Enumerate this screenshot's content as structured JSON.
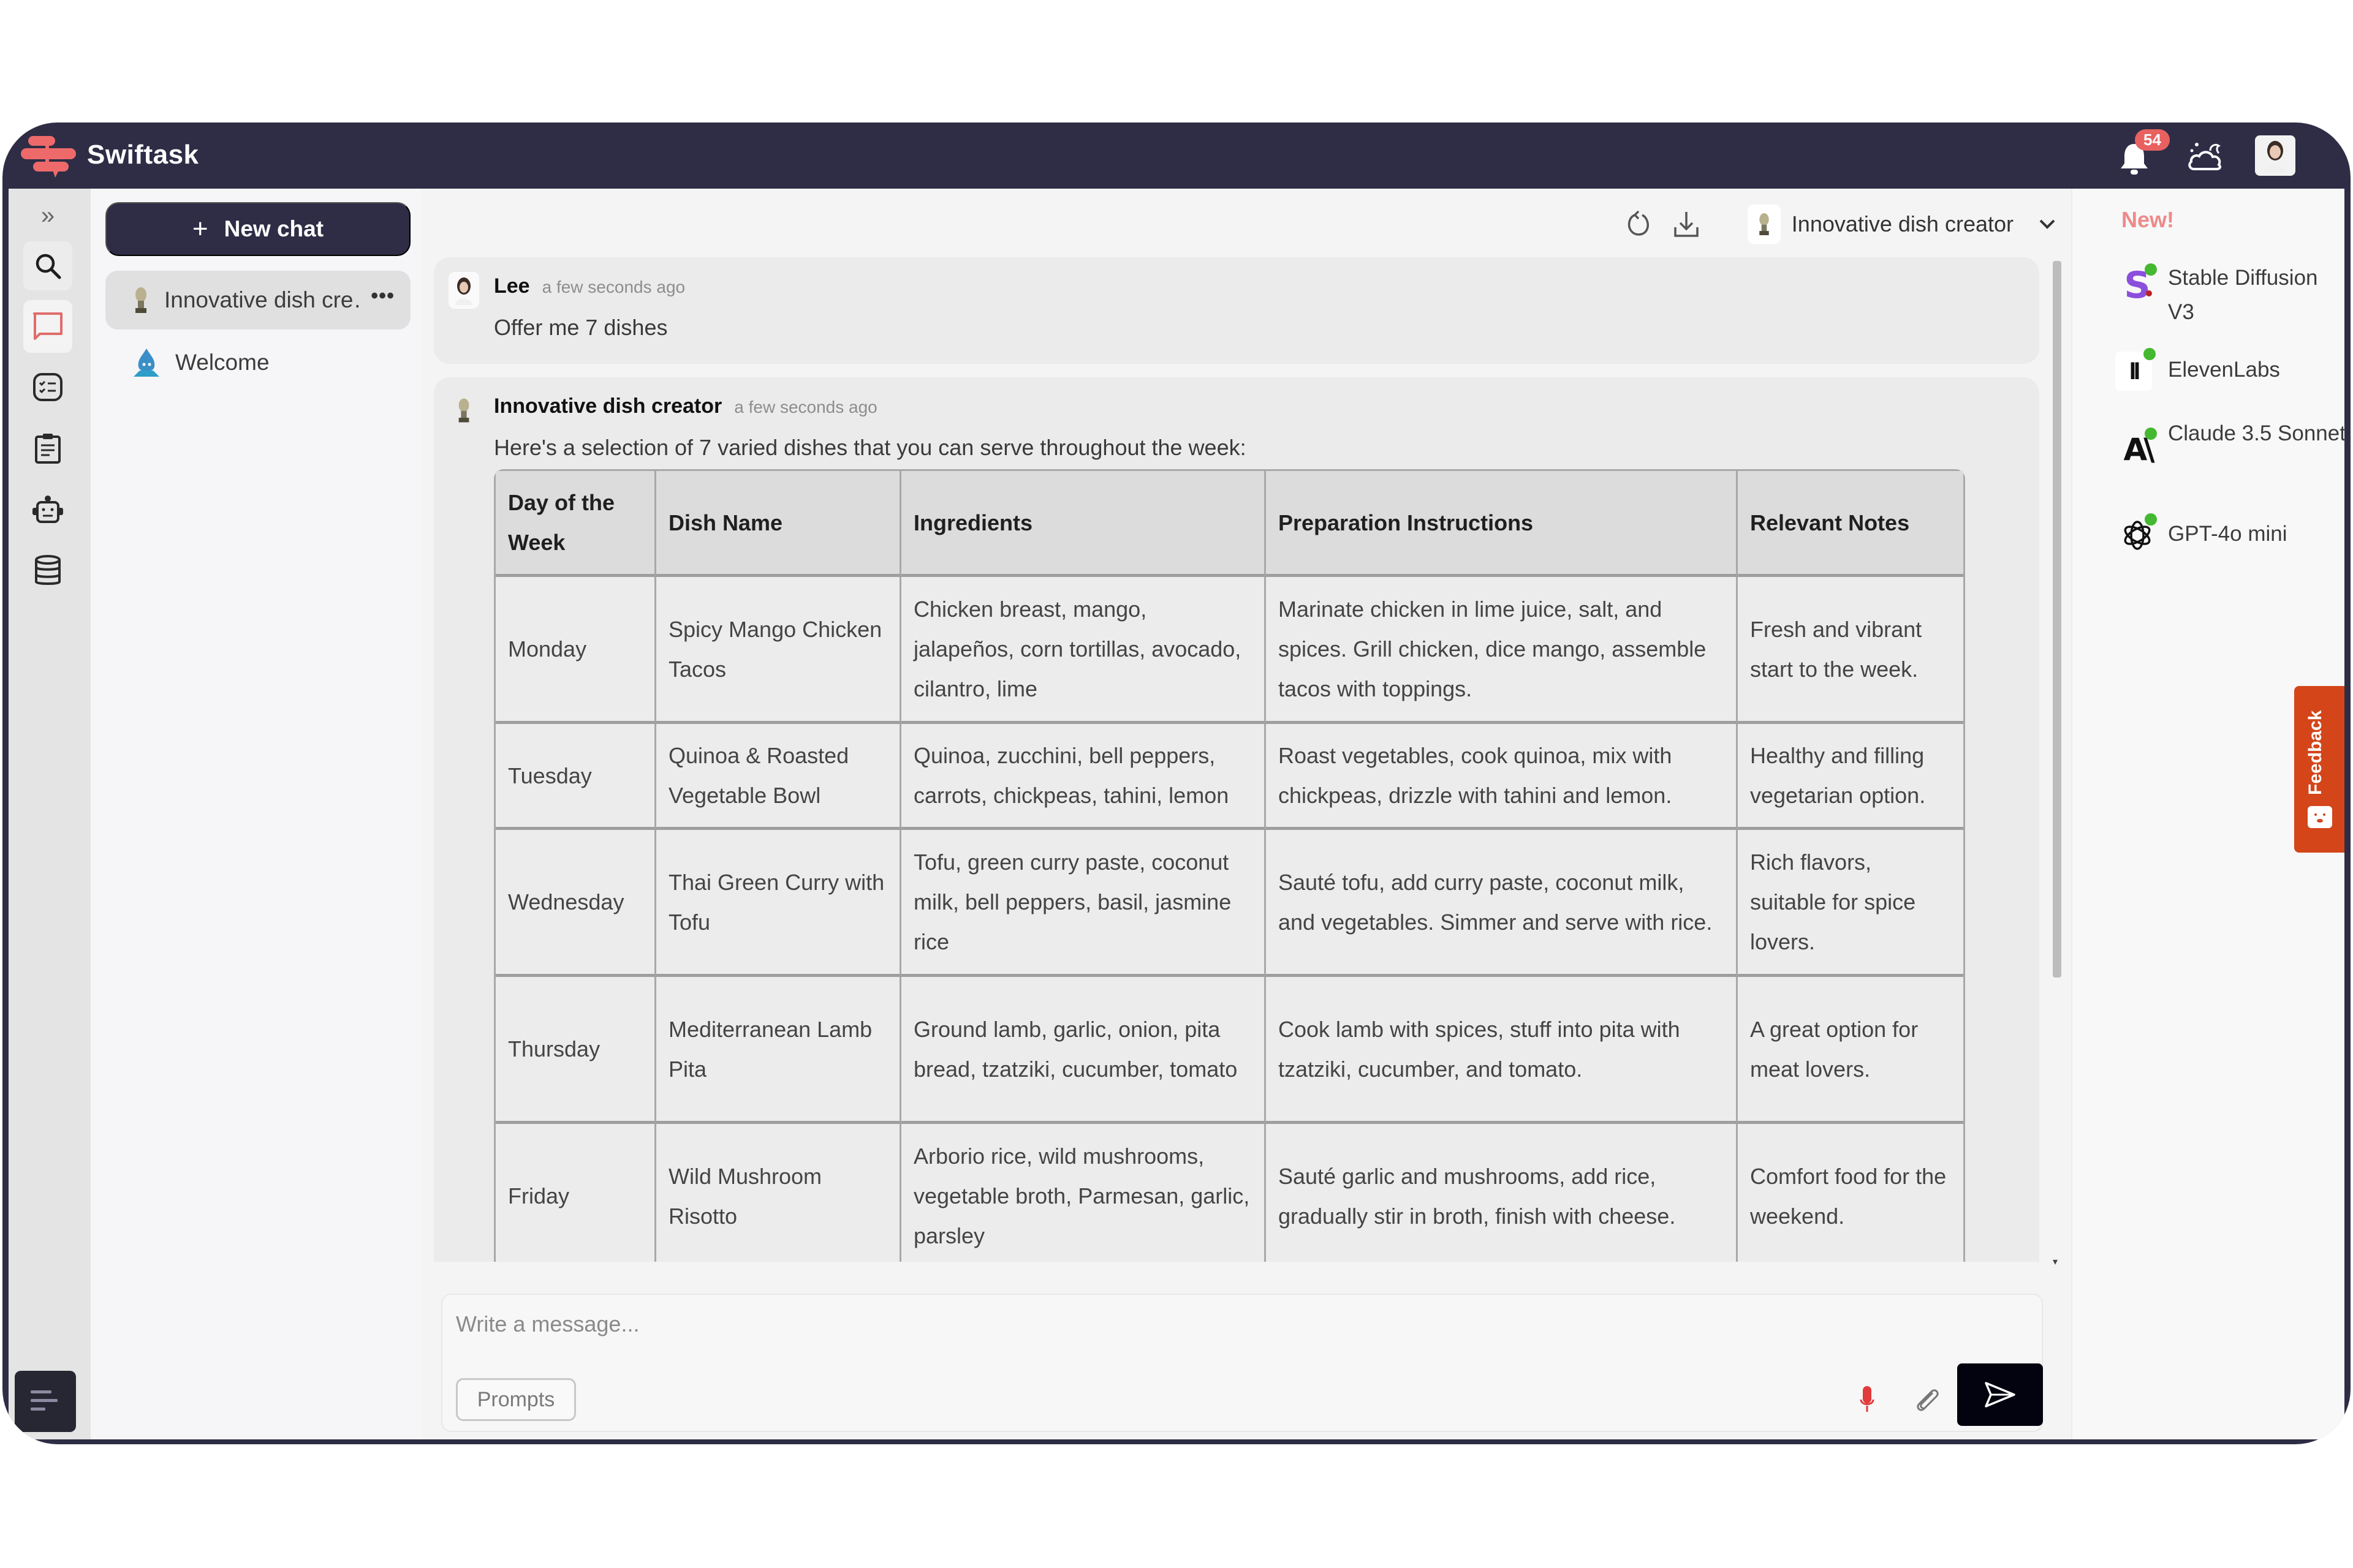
{
  "app": {
    "name": "Swiftask",
    "notification_count": "54",
    "brand_color": "#2e2d45",
    "accent_color": "#ee6a6a"
  },
  "rail": {
    "items": [
      {
        "icon": "expand-icon",
        "label": "Expand"
      },
      {
        "icon": "search-icon",
        "label": "Search"
      },
      {
        "icon": "chat-icon",
        "label": "Chats"
      },
      {
        "icon": "tasks-icon",
        "label": "Tasks"
      },
      {
        "icon": "clipboard-icon",
        "label": "Documents"
      },
      {
        "icon": "bot-icon",
        "label": "Agents"
      },
      {
        "icon": "database-icon",
        "label": "Data"
      }
    ]
  },
  "sidebar": {
    "new_chat_label": "New chat",
    "chats": [
      {
        "label": "Innovative dish cre…",
        "active": true,
        "more": "•••"
      },
      {
        "label": "Welcome",
        "active": false
      }
    ]
  },
  "header": {
    "agent_name": "Innovative dish creator"
  },
  "messages": [
    {
      "author": "Lee",
      "time": "a few seconds ago",
      "text": "Offer me 7 dishes"
    },
    {
      "author": "Innovative dish creator",
      "time": "a few seconds ago",
      "text": "Here's a selection of 7 varied dishes that you can serve throughout the week:"
    }
  ],
  "table": {
    "headers": [
      "Day of the Week",
      "Dish Name",
      "Ingredients",
      "Preparation Instructions",
      "Relevant Notes"
    ],
    "rows": [
      [
        "Monday",
        "Spicy Mango Chicken Tacos",
        "Chicken breast, mango, jalapeños, corn tortillas, avocado, cilantro, lime",
        "Marinate chicken in lime juice, salt, and spices. Grill chicken, dice mango, assemble tacos with toppings.",
        "Fresh and vibrant start to the week."
      ],
      [
        "Tuesday",
        "Quinoa & Roasted Vegetable Bowl",
        "Quinoa, zucchini, bell peppers, carrots, chickpeas, tahini, lemon",
        "Roast vegetables, cook quinoa, mix with chickpeas, drizzle with tahini and lemon.",
        "Healthy and filling vegetarian option."
      ],
      [
        "Wednesday",
        "Thai Green Curry with Tofu",
        "Tofu, green curry paste, coconut milk, bell peppers, basil, jasmine rice",
        "Sauté tofu, add curry paste, coconut milk, and vegetables. Simmer and serve with rice.",
        "Rich flavors, suitable for spice lovers."
      ],
      [
        "Thursday",
        "Mediterranean Lamb Pita",
        "Ground lamb, garlic, onion, pita bread, tzatziki, cucumber, tomato",
        "Cook lamb with spices, stuff into pita with tzatziki, cucumber, and tomato.",
        "A great option for meat lovers."
      ],
      [
        "Friday",
        "Wild Mushroom Risotto",
        "Arborio rice, wild mushrooms, vegetable broth, Parmesan, garlic, parsley",
        "Sauté garlic and mushrooms, add rice, gradually stir in broth, finish with cheese.",
        "Comfort food for the weekend."
      ]
    ]
  },
  "composer": {
    "placeholder": "Write a message...",
    "value": "",
    "prompts_label": "Prompts"
  },
  "right_panel": {
    "new_label": "New!",
    "models": [
      {
        "name": "Stable Diffusion V3",
        "icon": "stable-diffusion-icon",
        "online": true
      },
      {
        "name": "ElevenLabs",
        "icon": "elevenlabs-icon",
        "online": true
      },
      {
        "name": "Claude 3.5 Sonnet",
        "icon": "anthropic-icon",
        "online": true
      },
      {
        "name": "GPT-4o mini",
        "icon": "openai-icon",
        "online": true
      }
    ]
  },
  "feedback": {
    "label": "Feedback",
    "color": "#d4451a"
  }
}
